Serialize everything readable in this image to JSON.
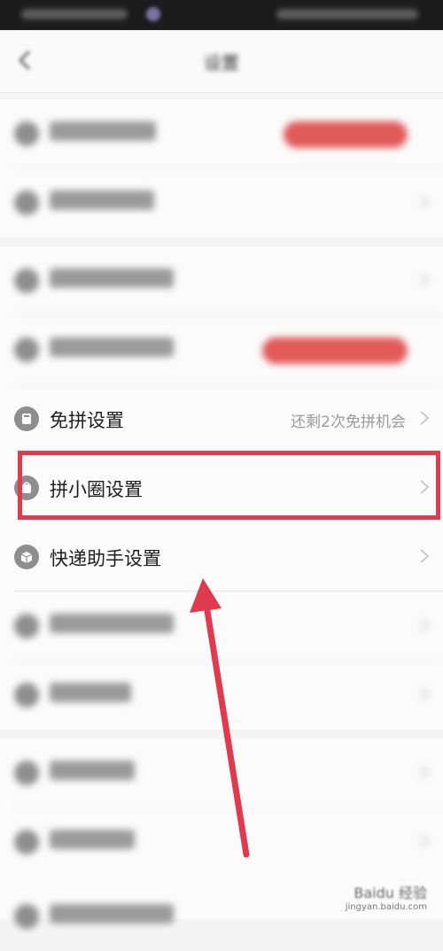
{
  "status_bar": {},
  "nav": {
    "title": "设置"
  },
  "sections": {
    "group1": [
      {
        "label": "",
        "pill": ""
      },
      {
        "label": ""
      }
    ],
    "group2": [
      {
        "label": ""
      },
      {
        "label": "",
        "pill": ""
      },
      {
        "label": "免拼设置",
        "hint": "还剩2次免拼机会",
        "icon": "coupon-icon"
      },
      {
        "label": "拼小圈设置",
        "icon": "circle-bag-icon"
      },
      {
        "label": "快递助手设置",
        "icon": "package-box-icon"
      }
    ],
    "group3": [
      {
        "label": ""
      },
      {
        "label": ""
      }
    ],
    "group4": [
      {
        "label": ""
      },
      {
        "label": ""
      },
      {
        "label": ""
      }
    ]
  },
  "watermark": {
    "text": "Baidu 经验",
    "url": "jingyan.baidu.com"
  },
  "colors": {
    "highlight": "#e03a4f",
    "pill": "#e25a5a"
  }
}
